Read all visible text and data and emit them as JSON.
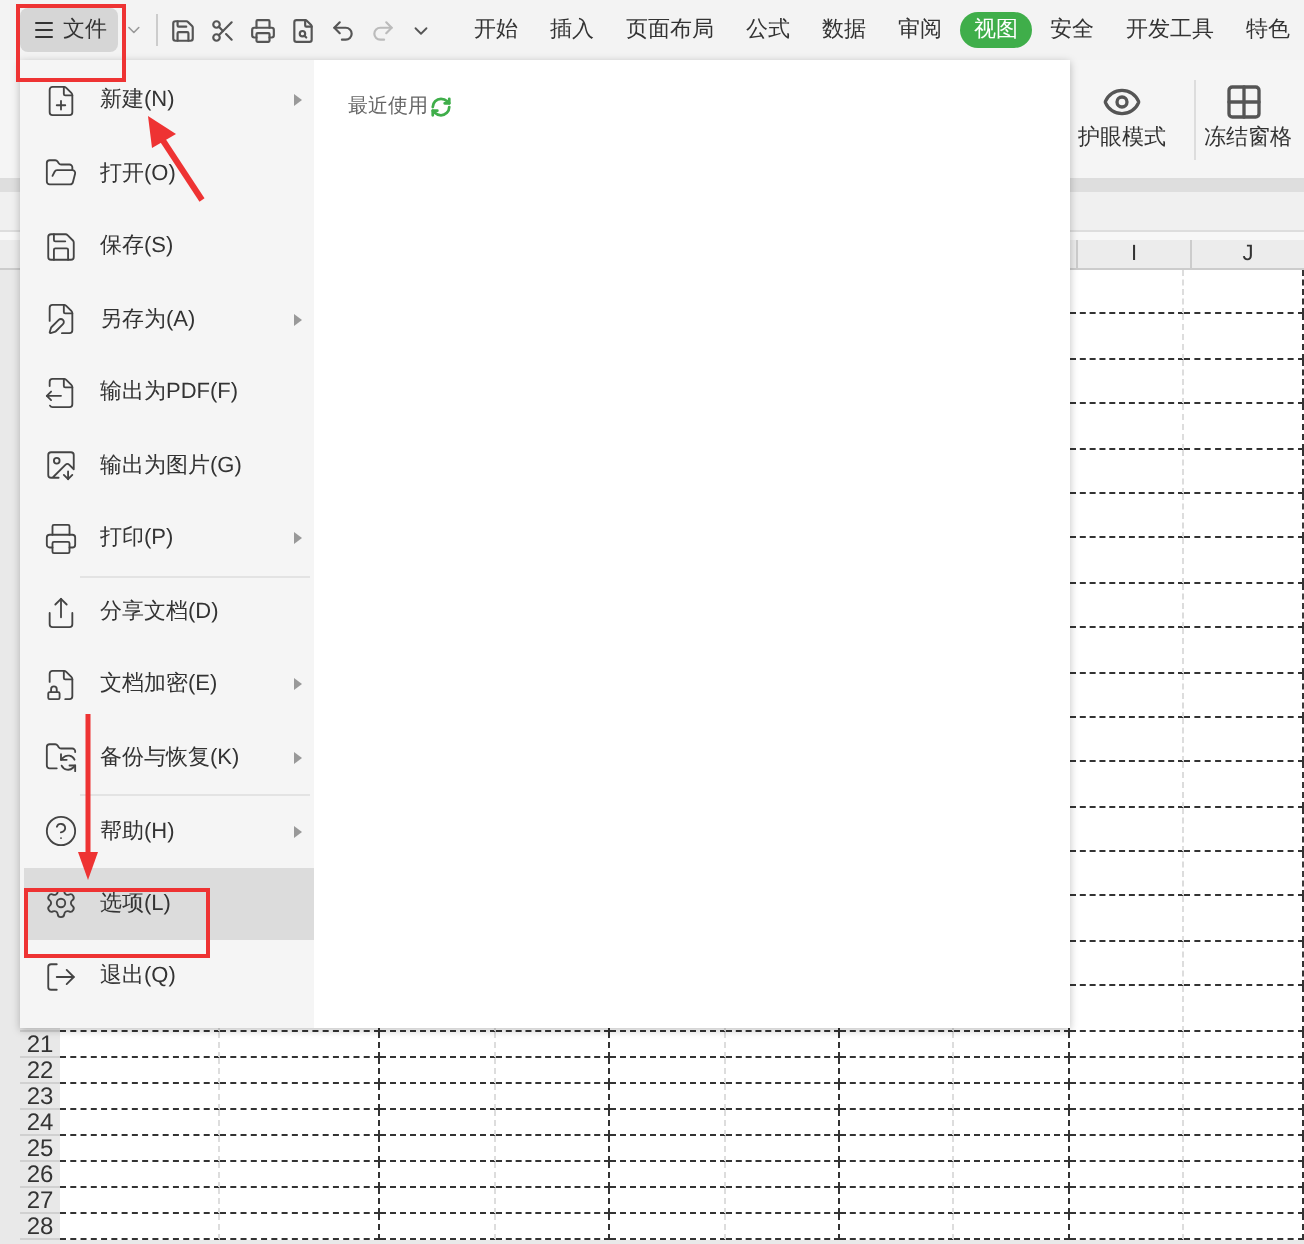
{
  "file_button": {
    "label": "文件"
  },
  "tabs": [
    {
      "label": "开始",
      "selected": false
    },
    {
      "label": "插入",
      "selected": false
    },
    {
      "label": "页面布局",
      "selected": false
    },
    {
      "label": "公式",
      "selected": false
    },
    {
      "label": "数据",
      "selected": false
    },
    {
      "label": "审阅",
      "selected": false
    },
    {
      "label": "视图",
      "selected": true
    },
    {
      "label": "安全",
      "selected": false
    },
    {
      "label": "开发工具",
      "selected": false
    },
    {
      "label": "特色",
      "selected": false
    }
  ],
  "ribbon": [
    {
      "label": "护眼模式"
    },
    {
      "label": "冻结窗格"
    }
  ],
  "columns": [
    "I",
    "J"
  ],
  "menu": {
    "items": [
      {
        "label": "新建(N)",
        "submenu": true,
        "selected": false,
        "divider_before": false
      },
      {
        "label": "打开(O)",
        "submenu": false,
        "selected": false,
        "divider_before": false
      },
      {
        "label": "保存(S)",
        "submenu": false,
        "selected": false,
        "divider_before": false
      },
      {
        "label": "另存为(A)",
        "submenu": true,
        "selected": false,
        "divider_before": false
      },
      {
        "label": "输出为PDF(F)",
        "submenu": false,
        "selected": false,
        "divider_before": false
      },
      {
        "label": "输出为图片(G)",
        "submenu": false,
        "selected": false,
        "divider_before": false
      },
      {
        "label": "打印(P)",
        "submenu": true,
        "selected": false,
        "divider_before": false
      },
      {
        "label": "分享文档(D)",
        "submenu": false,
        "selected": false,
        "divider_before": true
      },
      {
        "label": "文档加密(E)",
        "submenu": true,
        "selected": false,
        "divider_before": false
      },
      {
        "label": "备份与恢复(K)",
        "submenu": true,
        "selected": false,
        "divider_before": false
      },
      {
        "label": "帮助(H)",
        "submenu": true,
        "selected": false,
        "divider_before": true
      },
      {
        "label": "选项(L)",
        "submenu": false,
        "selected": true,
        "divider_before": false
      },
      {
        "label": "退出(Q)",
        "submenu": false,
        "selected": false,
        "divider_before": false
      }
    ],
    "recent_title": "最近使用"
  },
  "rows": [
    "21",
    "22",
    "23",
    "24",
    "25",
    "26",
    "27",
    "28"
  ]
}
